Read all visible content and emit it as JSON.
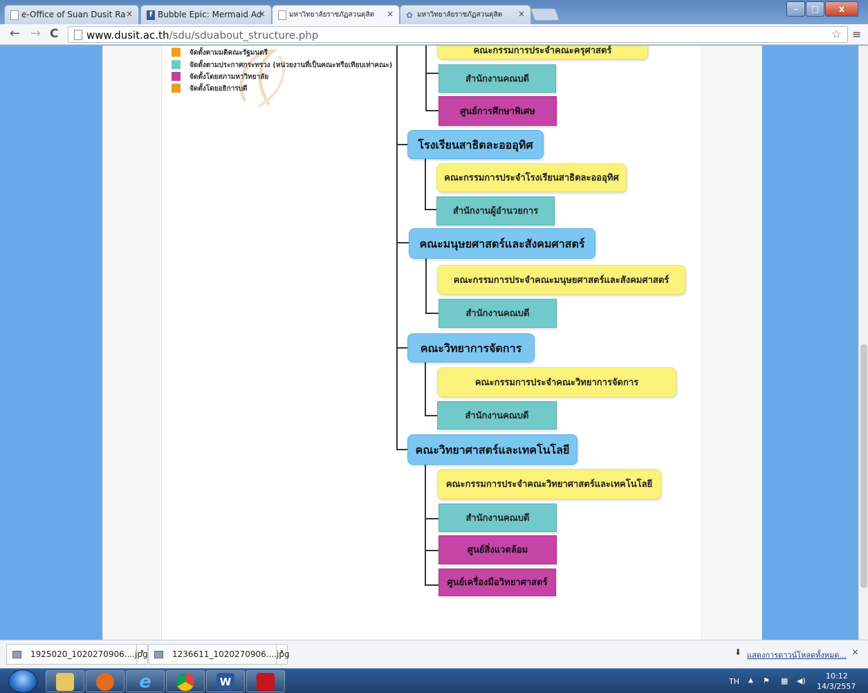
{
  "browser": {
    "tabs": [
      {
        "title": "e-Office of Suan Dusit Raj",
        "icon": "page-icon",
        "active": false
      },
      {
        "title": "Bubble Epic: Mermaid Adv",
        "icon": "facebook-icon",
        "active": false
      },
      {
        "title": "มหาวิทยาลัยราชภัฏสวนดุสิต",
        "icon": "page-icon",
        "active": true
      },
      {
        "title": "มหาวิทยาลัยราชภัฏสวนดุสิต",
        "icon": "sdu-logo-icon",
        "active": false
      }
    ],
    "close_glyph": "×",
    "url_host": "www.dusit.ac.th",
    "url_path": "/sdu/sduabout_structure.php",
    "window_buttons": {
      "minimize": "–",
      "maximize": "□",
      "close": "x"
    },
    "nav": {
      "back": "←",
      "forward": "→",
      "reload": "C",
      "star": "☆",
      "menu": "≡"
    }
  },
  "legend": [
    {
      "label": "จัดตั้งตามมติคณะรัฐมนตรี",
      "color": "#f0a01e"
    },
    {
      "label": "จัดตั้งตามประกาศกระทรวง (หน่วยงานที่เป็นคณะหรือเทียบเท่าคณะ)",
      "color": "#6ec9c9"
    },
    {
      "label": "จัดตั้งโดยสภามหาวิทยาลัย",
      "color": "#c2409f"
    },
    {
      "label": "จัดตั้งโดยอธิการบดี",
      "color": "#e8a020"
    }
  ],
  "org": {
    "top_partial": "คณะกรรมการประจำคณะครุศาสตร์",
    "top_children": [
      "สำนักงานคณบดี",
      "ศูนย์การศึกษาพิเศษ"
    ],
    "units": [
      {
        "name": "โรงเรียนสาธิตละอออุทิศ",
        "committee": "คณะกรรมการประจำโรงเรียนสาธิตละอออุทิศ",
        "children": [
          "สำนักงานผู้อำนวยการ"
        ]
      },
      {
        "name": "คณะมนุษยศาสตร์และสังคมศาสตร์",
        "committee": "คณะกรรมการประจำคณะมนุษยศาสตร์และสังคมศาสตร์",
        "children": [
          "สำนักงานคณบดี"
        ]
      },
      {
        "name": "คณะวิทยาการจัดการ",
        "committee": "คณะกรรมการประจำคณะวิทยาการจัดการ",
        "children": [
          "สำนักงานคณบดี"
        ]
      },
      {
        "name": "คณะวิทยาศาสตร์และเทคโนโลยี",
        "committee": "คณะกรรมการประจำคณะวิทยาศาสตร์และเทคโนโลยี",
        "children": [
          "สำนักงานคณบดี",
          "ศูนย์สิ่งแวดล้อม",
          "ศูนย์เครื่องมือวิทยาศาสตร์"
        ]
      }
    ]
  },
  "downloads": {
    "items": [
      "1925020_1020270906....jpg",
      "1236611_1020270906....jpg"
    ],
    "arrow": "▾",
    "show_all": "แสดงการดาวน์โหลดทั้งหมด...",
    "close": "×"
  },
  "taskbar": {
    "apps": [
      "explorer",
      "media-player",
      "internet-explorer",
      "chrome",
      "word",
      "acrobat"
    ],
    "word_glyph": "W",
    "ie_glyph": "e",
    "lang": "TH",
    "tray_caret": "▲",
    "time": "10:12",
    "date": "14/3/2557"
  }
}
